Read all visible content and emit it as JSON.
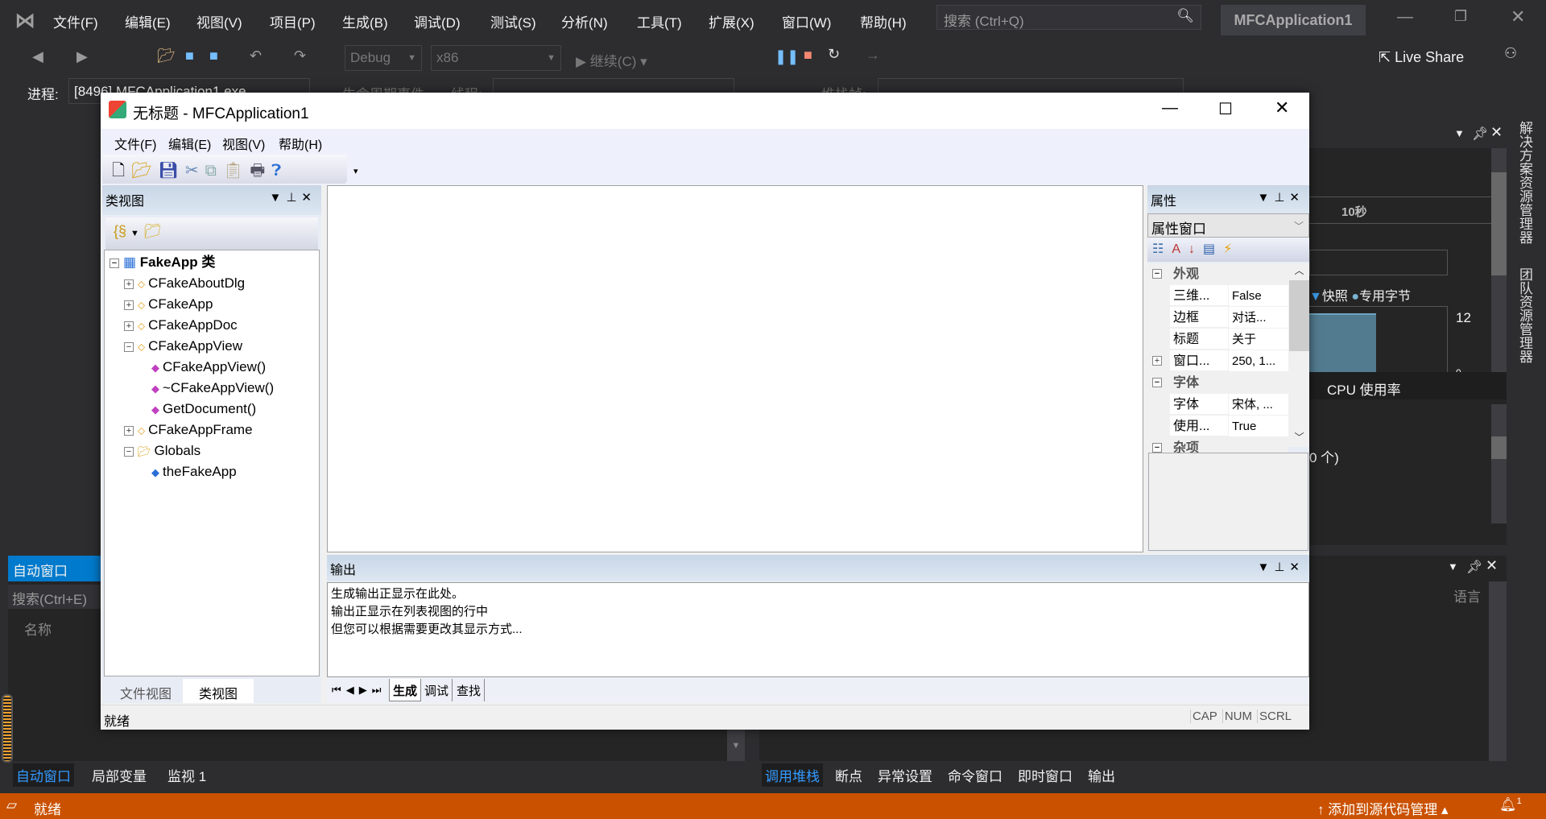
{
  "vs": {
    "menu": [
      "文件(F)",
      "编辑(E)",
      "视图(V)",
      "项目(P)",
      "生成(B)",
      "调试(D)",
      "测试(S)",
      "分析(N)",
      "工具(T)",
      "扩展(X)",
      "窗口(W)",
      "帮助(H)"
    ],
    "search_placeholder": "搜索 (Ctrl+Q)",
    "solution_name": "MFCApplication1",
    "toolbar": {
      "config": "Debug",
      "platform": "x86",
      "continue": "继续(C)",
      "live_share": "Live Share"
    },
    "debug_bar": {
      "process_label": "进程:",
      "process_value": "[8496] MFCApplication1.exe",
      "lifecycle": "生命周期事件",
      "thread_label": "线程:",
      "stack_label": "堆栈帧:"
    },
    "diag": {
      "timeline": "10秒",
      "legend_snapshot": "快照",
      "legend_bytes": "专用字节",
      "y_max": "12",
      "y_min": "0",
      "cpu_tab": "CPU 使用率",
      "count_text": "0 个)"
    },
    "side_tabs": [
      "解决方案资源管理器",
      "团队资源管理器"
    ],
    "auto_window": {
      "title": "自动窗口",
      "search": "搜索(Ctrl+E)",
      "col_name": "名称"
    },
    "right_lower": {
      "col_lang": "语言"
    },
    "bottom_tabs_left": [
      "自动窗口",
      "局部变量",
      "监视 1"
    ],
    "bottom_tabs_right": [
      "调用堆栈",
      "断点",
      "异常设置",
      "命令窗口",
      "即时窗口",
      "输出"
    ],
    "status": {
      "ready": "就绪",
      "source_control": "添加到源代码管理",
      "notifications": "1"
    },
    "colors": {
      "bg": "#2d2d30",
      "status": "#ca5100",
      "accent": "#007acc"
    }
  },
  "app": {
    "title": "无标题 - MFCApplication1",
    "menu": [
      "文件(F)",
      "编辑(E)",
      "视图(V)",
      "帮助(H)"
    ],
    "classview": {
      "title": "类视图",
      "root": "FakeApp 类",
      "items": [
        {
          "label": "CFakeAboutDlg",
          "exp": "+",
          "lvl": 1,
          "icon": "class-icon"
        },
        {
          "label": "CFakeApp",
          "exp": "+",
          "lvl": 1,
          "icon": "class-icon"
        },
        {
          "label": "CFakeAppDoc",
          "exp": "+",
          "lvl": 1,
          "icon": "class-icon"
        },
        {
          "label": "CFakeAppView",
          "exp": "−",
          "lvl": 1,
          "icon": "class-icon"
        },
        {
          "label": "CFakeAppView()",
          "exp": "",
          "lvl": 2,
          "icon": "method-icon"
        },
        {
          "label": "~CFakeAppView()",
          "exp": "",
          "lvl": 2,
          "icon": "method-icon"
        },
        {
          "label": "GetDocument()",
          "exp": "",
          "lvl": 2,
          "icon": "method-icon"
        },
        {
          "label": "CFakeAppFrame",
          "exp": "+",
          "lvl": 1,
          "icon": "class-icon"
        },
        {
          "label": "Globals",
          "exp": "−",
          "lvl": 1,
          "icon": "folder-icon"
        },
        {
          "label": "theFakeApp",
          "exp": "",
          "lvl": 2,
          "icon": "variable-icon"
        }
      ],
      "tabs": [
        "文件视图",
        "类视图"
      ]
    },
    "properties": {
      "title": "属性",
      "combo": "属性窗口",
      "rows": [
        {
          "cat": true,
          "exp": "−",
          "name": "外观"
        },
        {
          "name": "三维...",
          "value": "False"
        },
        {
          "name": "边框",
          "value": "对话..."
        },
        {
          "name": "标题",
          "value": "关于"
        },
        {
          "exp": "+",
          "name": "窗口...",
          "value": "250, 1..."
        },
        {
          "cat": true,
          "exp": "−",
          "name": "字体"
        },
        {
          "name": "字体",
          "value": "宋体, ..."
        },
        {
          "name": "使用...",
          "value": "True"
        },
        {
          "cat": true,
          "exp": "−",
          "name": "杂项"
        }
      ]
    },
    "output": {
      "title": "输出",
      "lines": [
        "生成输出正显示在此处。",
        "输出正显示在列表视图的行中",
        "但您可以根据需要更改其显示方式..."
      ],
      "tabs": [
        "生成",
        "调试",
        "查找"
      ]
    },
    "status": {
      "text": "就绪",
      "indicators": [
        "CAP",
        "NUM",
        "SCRL"
      ]
    }
  }
}
